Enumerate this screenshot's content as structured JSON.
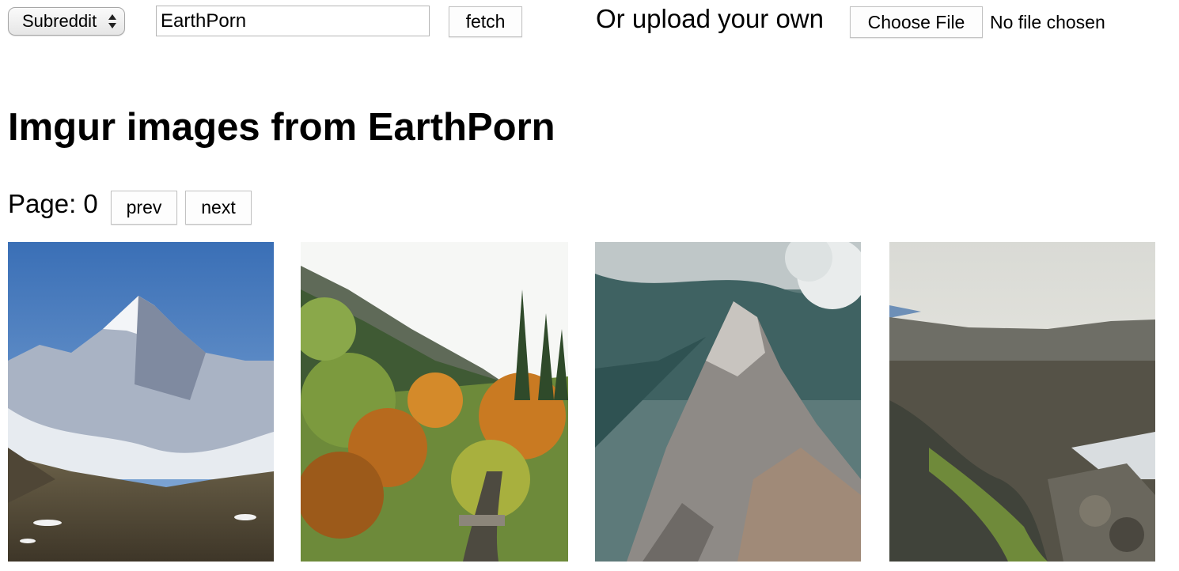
{
  "toolbar": {
    "source_select_value": "Subreddit",
    "subreddit_input_value": "EarthPorn",
    "fetch_label": "fetch",
    "upload_label": "Or upload your own",
    "choose_file_label": "Choose File",
    "file_status": "No file chosen"
  },
  "heading": "Imgur images from EarthPorn",
  "pagination": {
    "page_text": "Page: 0",
    "prev_label": "prev",
    "next_label": "next"
  },
  "gallery": {
    "images": [
      {
        "subject": "snow-capped mountain peak above clouds"
      },
      {
        "subject": "autumn foliage trail with evergreens"
      },
      {
        "subject": "aerial rocky mountain ridge with clouds"
      },
      {
        "subject": "coastal cliffs and rocky stream"
      }
    ]
  }
}
